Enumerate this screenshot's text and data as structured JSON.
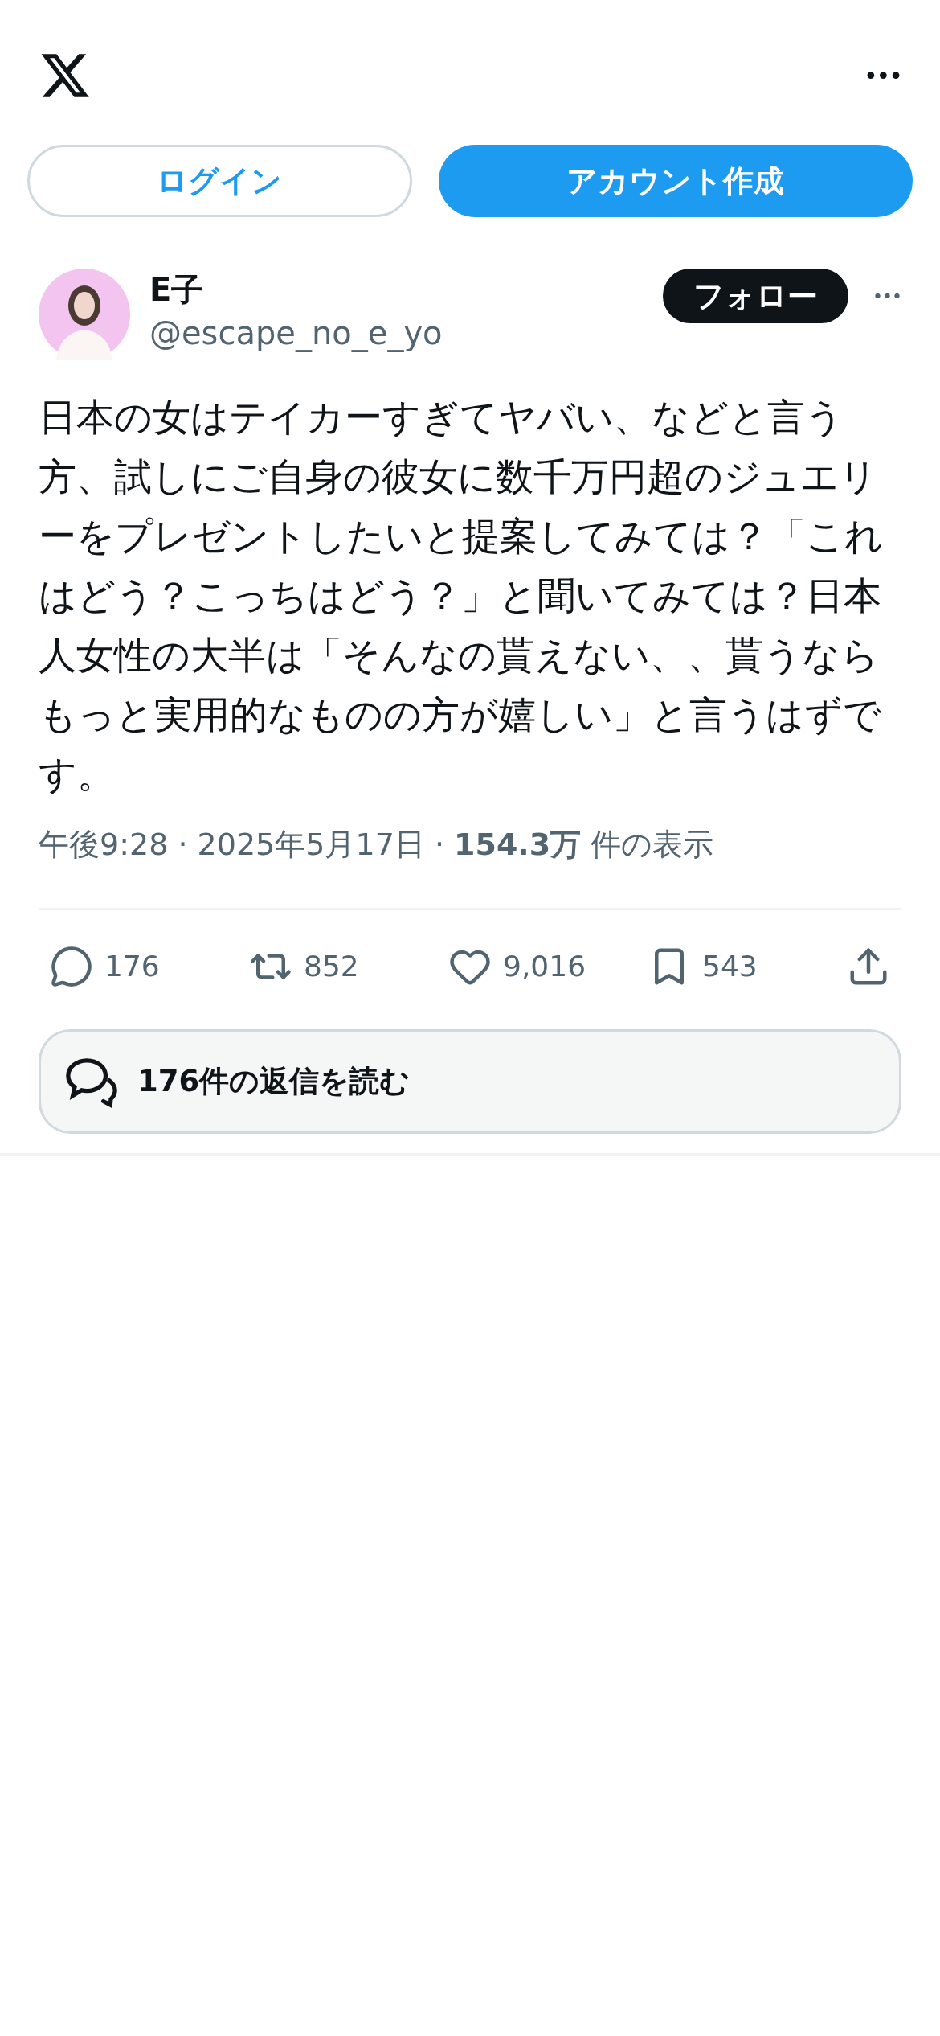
{
  "header": {
    "menu_label": "•••"
  },
  "auth_buttons": [
    {
      "label": "ログイン",
      "kind": "outline"
    },
    {
      "label": "アカウント作成",
      "kind": "filled"
    }
  ],
  "post": {
    "author": {
      "name": "E子",
      "handle": "@escape_no_e_yo"
    },
    "follow_label": "フォロー",
    "more_label": "•••",
    "text": "日本の女はテイカーすぎてヤバい、などと言う方、試しにご自身の彼女に数千万円超のジュエリーをプレゼントしたいと提案してみては？「これはどう？こっちはどう？」と聞いてみては？日本人女性の大半は「そんなの貰えない、、貰うならもっと実用的なものの方が嬉しい」と言うはずです。",
    "meta": "午後9:28 · 2025年5月17日 · **154.3万** 件の表示",
    "actions": [
      {
        "kind": "reply",
        "count": "176"
      },
      {
        "kind": "repost",
        "count": "852"
      },
      {
        "kind": "like",
        "count": "9,016"
      },
      {
        "kind": "bookmark",
        "count": "543"
      },
      {
        "kind": "share"
      }
    ],
    "read_replies": "176件の返信を読む"
  }
}
